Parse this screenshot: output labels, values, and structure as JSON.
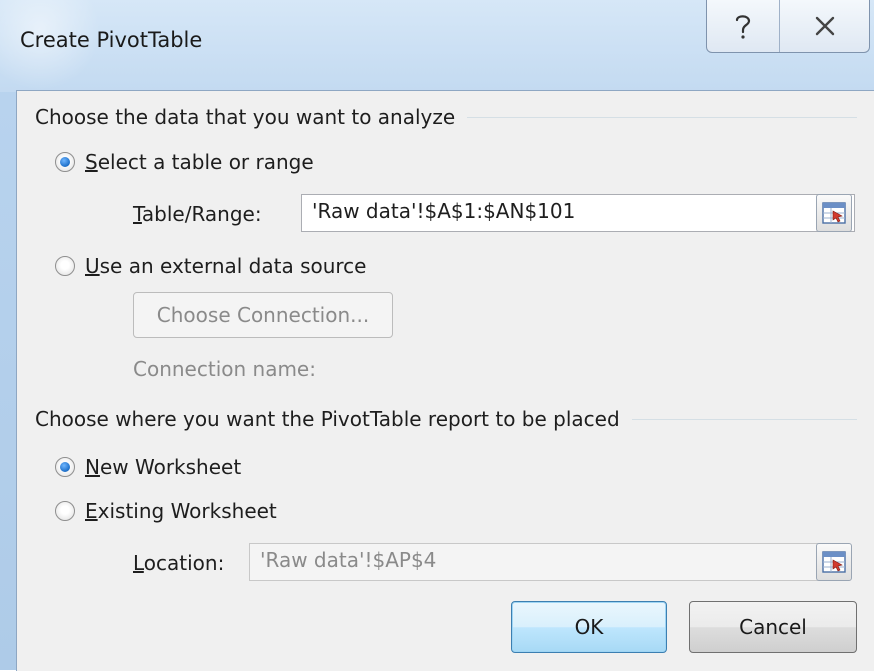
{
  "window": {
    "title": "Create PivotTable",
    "help_icon": "question-mark-icon",
    "close_icon": "close-x-icon"
  },
  "data_source": {
    "heading": "Choose the data that you want to analyze",
    "option_table": {
      "mnemonic": "S",
      "rest": "elect a table or range",
      "checked": true
    },
    "table_range_label": {
      "mnemonic": "T",
      "rest": "able/Range:"
    },
    "table_range_value": "'Raw data'!$A$1:$AN$101",
    "option_external": {
      "mnemonic": "U",
      "rest": "se an external data source",
      "checked": false
    },
    "choose_connection_label": "Choose Connection...",
    "connection_name_label": "Connection name:"
  },
  "placement": {
    "heading": "Choose where you want the PivotTable report to be placed",
    "option_new": {
      "mnemonic": "N",
      "rest": "ew Worksheet",
      "checked": true
    },
    "option_existing": {
      "mnemonic": "E",
      "rest": "xisting Worksheet",
      "checked": false
    },
    "location_label": {
      "mnemonic": "L",
      "rest": "ocation:"
    },
    "location_value": "'Raw data'!$AP$4"
  },
  "buttons": {
    "ok": "OK",
    "cancel": "Cancel"
  },
  "colors": {
    "titlebar": "#c3daf1",
    "client_bg": "#f0f0f0",
    "radio_selected": "#1c6ec8",
    "default_button": "#bee6fd"
  }
}
